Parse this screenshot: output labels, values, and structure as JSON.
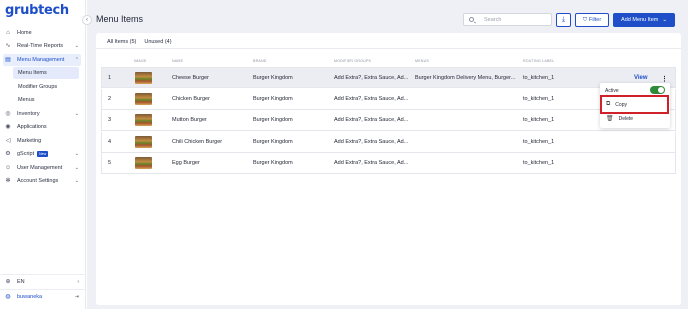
{
  "brand": {
    "logo_text": "grubtech"
  },
  "sidebar": {
    "items": [
      {
        "label": "Home",
        "icon": "home-icon"
      },
      {
        "label": "Real-Time Reports",
        "icon": "chart-icon"
      },
      {
        "label": "Menu Management",
        "icon": "menu-icon"
      },
      {
        "label": "Inventory",
        "icon": "inventory-icon"
      },
      {
        "label": "Applications",
        "icon": "apps-icon"
      },
      {
        "label": "Marketing",
        "icon": "megaphone-icon"
      },
      {
        "label": "gScript",
        "icon": "script-icon",
        "badge": "New"
      },
      {
        "label": "User Management",
        "icon": "user-icon"
      },
      {
        "label": "Account Settings",
        "icon": "settings-icon"
      }
    ],
    "submenu": [
      "Menu Items",
      "Modifier Groups",
      "Menus"
    ],
    "language": "EN",
    "user": "buwaneka"
  },
  "header": {
    "title": "Menu Items",
    "search_placeholder": "Search",
    "filter_label": "Filter",
    "add_label": "Add Menu Item"
  },
  "tabs": [
    "All Items (5)",
    "Unused (4)"
  ],
  "table": {
    "columns": [
      "IMAGE",
      "NAME",
      "BRAND",
      "MODIFIER GROUPS",
      "MENUS",
      "ROUTING LABEL"
    ],
    "rows": [
      {
        "num": "1",
        "name": "Cheese Burger",
        "brand": "Burger Kingdom",
        "modifiers": "Add Extra?, Extra Sauce, Ad...",
        "menus": "Burger Kingdom Delivery Menu, Burger...",
        "routing": "to_kitchen_1"
      },
      {
        "num": "2",
        "name": "Chicken Burger",
        "brand": "Burger Kingdom",
        "modifiers": "Add Extra?, Extra Sauce, Ad...",
        "menus": "",
        "routing": "to_kitchen_1"
      },
      {
        "num": "3",
        "name": "Mutton Burger",
        "brand": "Burger Kingdom",
        "modifiers": "Add Extra?, Extra Sauce, Ad...",
        "menus": "",
        "routing": "to_kitchen_1"
      },
      {
        "num": "4",
        "name": "Chili Chicken Burger",
        "brand": "Burger Kingdom",
        "modifiers": "Add Extra?, Extra Sauce, Ad...",
        "menus": "",
        "routing": "to_kitchen_1"
      },
      {
        "num": "5",
        "name": "Egg Burger",
        "brand": "Burger Kingdom",
        "modifiers": "Add Extra?, Extra Sauce, Ad...",
        "menus": "",
        "routing": "to_kitchen_1"
      }
    ],
    "view_label": "View"
  },
  "row_menu": {
    "active_label": "Active",
    "active_on": true,
    "copy_label": "Copy",
    "delete_label": "Delete"
  },
  "colors": {
    "accent": "#1e4fc8",
    "toggle_on": "#2e8b3a",
    "highlight": "#d0202a"
  }
}
